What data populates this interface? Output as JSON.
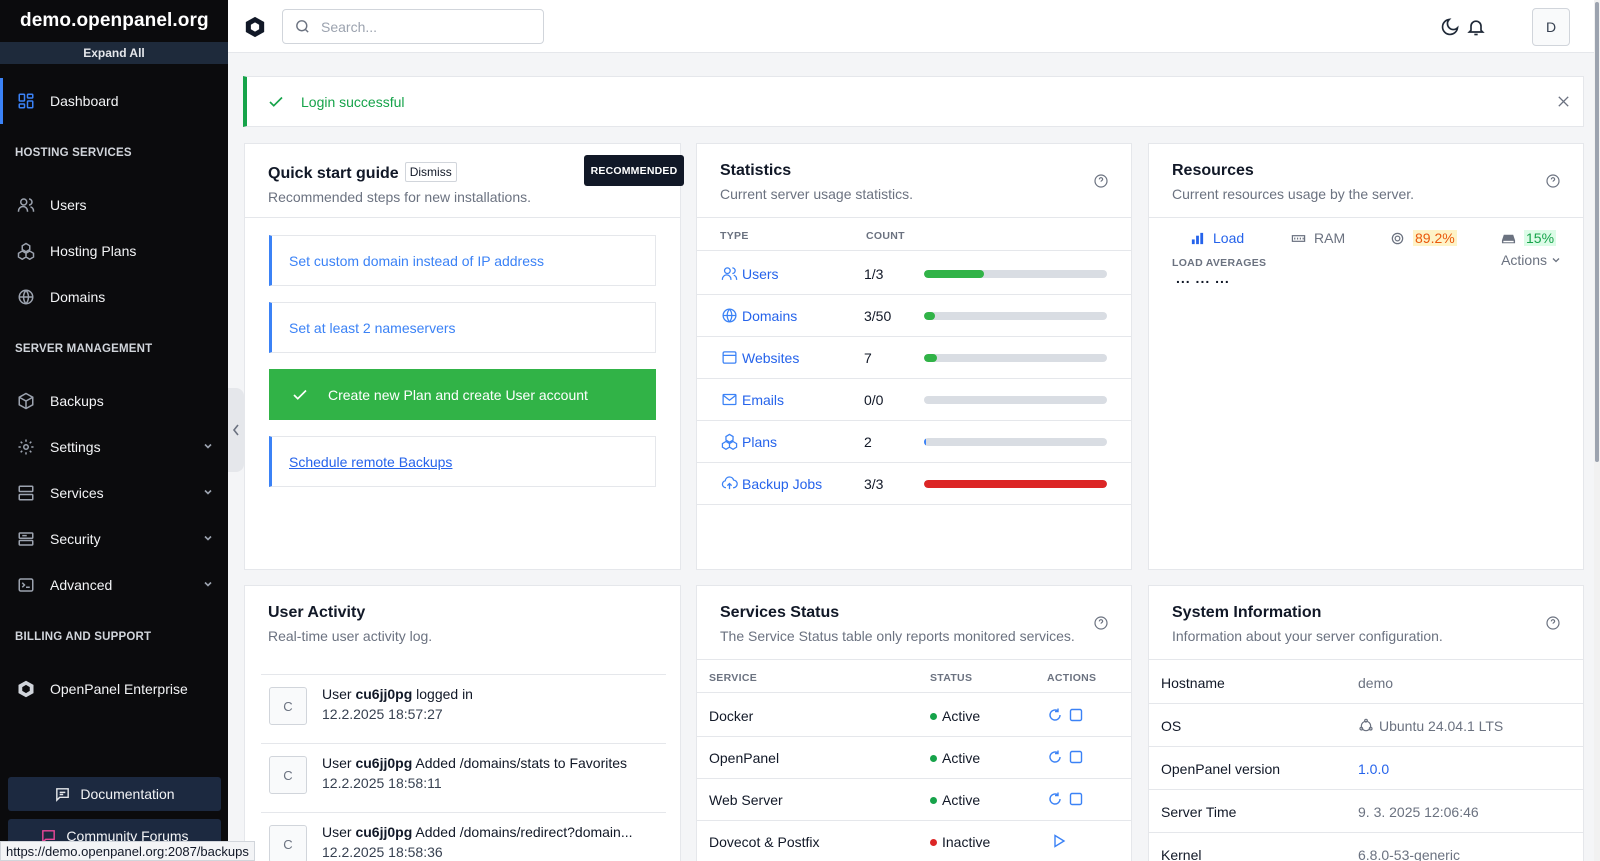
{
  "sidebar": {
    "brand": "demo.openpanel.org",
    "expand_all": "Expand All",
    "dashboard": "Dashboard",
    "sections": {
      "hosting": "HOSTING SERVICES",
      "server": "SERVER MANAGEMENT",
      "billing": "BILLING AND SUPPORT"
    },
    "items": {
      "users": "Users",
      "plans": "Hosting Plans",
      "domains": "Domains",
      "backups": "Backups",
      "settings": "Settings",
      "services": "Services",
      "security": "Security",
      "advanced": "Advanced",
      "enterprise": "OpenPanel Enterprise"
    },
    "documentation": "Documentation",
    "forums": "Community Forums"
  },
  "header": {
    "search_placeholder": "Search...",
    "avatar": "D"
  },
  "alert": {
    "message": "Login successful"
  },
  "quickstart": {
    "title": "Quick start guide",
    "dismiss": "Dismiss",
    "subtitle": "Recommended steps for new installations.",
    "badge": "RECOMMENDED",
    "steps": [
      "Set custom domain instead of IP address",
      "Set at least 2 nameservers",
      "Create new Plan and create User account",
      "Schedule remote Backups"
    ]
  },
  "statistics": {
    "title": "Statistics",
    "subtitle": "Current server usage statistics.",
    "col_type": "TYPE",
    "col_count": "COUNT",
    "rows": [
      {
        "name": "Users",
        "count": "1/3",
        "fraction": 0.33,
        "color": "#31b347"
      },
      {
        "name": "Domains",
        "count": "3/50",
        "fraction": 0.06,
        "color": "#31b347"
      },
      {
        "name": "Websites",
        "count": "7",
        "fraction": 0.07,
        "color": "#31b347"
      },
      {
        "name": "Emails",
        "count": "0/0",
        "fraction": 0,
        "color": "#31b347"
      },
      {
        "name": "Plans",
        "count": "2",
        "fraction": 0.01,
        "color": "#3b82f6"
      },
      {
        "name": "Backup Jobs",
        "count": "3/3",
        "fraction": 1,
        "color": "#dc2626"
      }
    ]
  },
  "resources": {
    "title": "Resources",
    "subtitle": "Current resources usage by the server.",
    "tab_load": "Load",
    "tab_ram": "RAM",
    "cpu": "89.2%",
    "disk": "15%",
    "load_label": "LOAD AVERAGES",
    "actions": "Actions",
    "load_values": "... ... ..."
  },
  "activity": {
    "title": "User Activity",
    "subtitle": "Real-time user activity log.",
    "items": [
      {
        "avatar": "C",
        "prefix": "User ",
        "user": "cu6jj0pg",
        "action": " logged in",
        "time": "12.2.2025 18:57:27"
      },
      {
        "avatar": "C",
        "prefix": "User ",
        "user": "cu6jj0pg",
        "action": " Added /domains/stats to Favorites",
        "time": "12.2.2025 18:58:11"
      },
      {
        "avatar": "C",
        "prefix": "User ",
        "user": "cu6jj0pg",
        "action": " Added /domains/redirect?domain...",
        "time": "12.2.2025 18:58:36"
      }
    ]
  },
  "services": {
    "title": "Services Status",
    "subtitle": "The Service Status table only reports monitored services.",
    "col_service": "SERVICE",
    "col_status": "STATUS",
    "col_actions": "ACTIONS",
    "rows": [
      {
        "name": "Docker",
        "status": "Active",
        "color": "#16a34a"
      },
      {
        "name": "OpenPanel",
        "status": "Active",
        "color": "#16a34a"
      },
      {
        "name": "Web Server",
        "status": "Active",
        "color": "#16a34a"
      },
      {
        "name": "Dovecot & Postfix",
        "status": "Inactive",
        "color": "#dc2626"
      }
    ]
  },
  "sysinfo": {
    "title": "System Information",
    "subtitle": "Information about your server configuration.",
    "rows": [
      {
        "key": "Hostname",
        "value": "demo"
      },
      {
        "key": "OS",
        "value": "Ubuntu 24.04.1 LTS"
      },
      {
        "key": "OpenPanel version",
        "value": "1.0.0"
      },
      {
        "key": "Server Time",
        "value": "9. 3. 2025 12:06:46"
      },
      {
        "key": "Kernel",
        "value": "6.8.0-53-generic"
      }
    ]
  },
  "status_url": "https://demo.openpanel.org:2087/backups"
}
